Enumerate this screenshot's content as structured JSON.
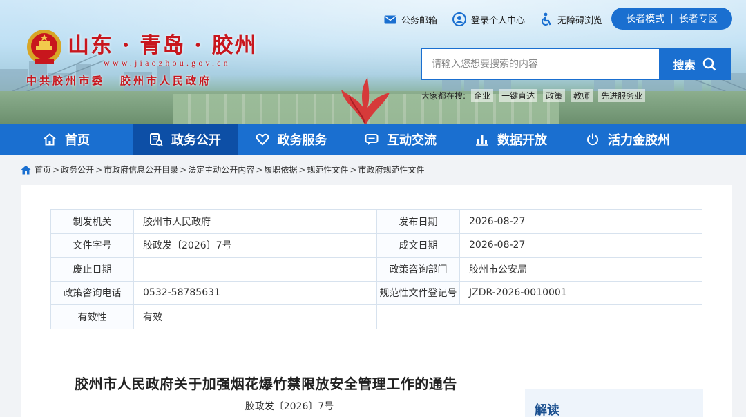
{
  "header": {
    "logo_title": "山东 · 青岛 · 胶州",
    "logo_url": "www.jiaozhou.gov.cn",
    "org_left": "中共胶州市委",
    "org_right": "胶州市人民政府",
    "top_links": [
      {
        "label": "公务邮箱",
        "icon": "mail-icon"
      },
      {
        "label": "登录个人中心",
        "icon": "user-icon"
      },
      {
        "label": "无障碍浏览",
        "icon": "accessibility-icon"
      }
    ],
    "elder_mode": "长者模式",
    "elder_zone": "长者专区",
    "search_placeholder": "请输入您想要搜索的内容",
    "search_button": "搜索",
    "hot_label": "大家都在搜:",
    "hot_tags": [
      "企业",
      "一键直达",
      "政策",
      "教师",
      "先进服务业"
    ]
  },
  "nav": [
    {
      "label": "首页",
      "icon": "home-icon"
    },
    {
      "label": "政务公开",
      "icon": "document-icon",
      "active": true
    },
    {
      "label": "政务服务",
      "icon": "heart-icon"
    },
    {
      "label": "互动交流",
      "icon": "chat-icon"
    },
    {
      "label": "数据开放",
      "icon": "bar-chart-icon"
    },
    {
      "label": "活力金胶州",
      "icon": "power-icon"
    }
  ],
  "breadcrumb": [
    "首页",
    "政务公开",
    "市政府信息公开目录",
    "法定主动公开内容",
    "履职依据",
    "规范性文件",
    "市政府规范性文件"
  ],
  "meta": {
    "issuer_label": "制发机关",
    "issuer": "胶州市人民政府",
    "publish_date_label": "发布日期",
    "publish_date": "2026-08-27",
    "doc_no_label": "文件字号",
    "doc_no": "胶政发〔2026〕7号",
    "written_date_label": "成文日期",
    "written_date": "2026-08-27",
    "repeal_date_label": "废止日期",
    "repeal_date": "",
    "consult_dept_label": "政策咨询部门",
    "consult_dept": "胶州市公安局",
    "consult_phone_label": "政策咨询电话",
    "consult_phone": "0532-58785631",
    "reg_no_label": "规范性文件登记号",
    "reg_no": "JZDR-2026-0010001",
    "validity_label": "有效性",
    "validity": "有效"
  },
  "document": {
    "title": "胶州市人民政府关于加强烟花爆竹禁限放安全管理工作的通告",
    "number": "胶政发〔2026〕7号"
  },
  "side": {
    "title": "解读"
  },
  "colors": {
    "brand_blue": "#1a6fd0",
    "nav_active": "#0d4fa6",
    "logo_red": "#c8161d"
  }
}
